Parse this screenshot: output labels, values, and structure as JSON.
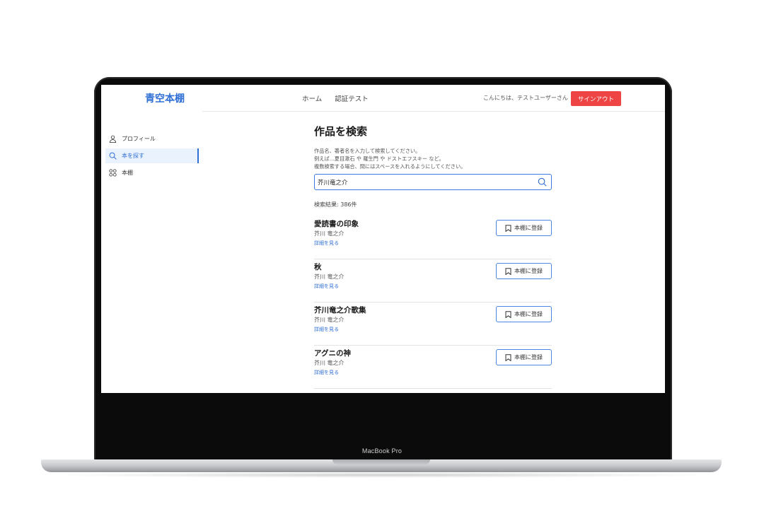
{
  "device": {
    "label": "MacBook Pro"
  },
  "header": {
    "logo": "青空本棚",
    "nav": [
      {
        "label": "ホーム"
      },
      {
        "label": "認証テスト"
      }
    ],
    "greeting": "こんにちは、テストユーザーさん",
    "signout_label": "サインアウト",
    "signout_color": "#ef4444",
    "accent_color": "#2f6fd6"
  },
  "sidebar": {
    "items": [
      {
        "label": "プロフィール",
        "icon": "user-icon",
        "active": false
      },
      {
        "label": "本を探す",
        "icon": "search-icon",
        "active": true
      },
      {
        "label": "本棚",
        "icon": "grid-icon",
        "active": false
      }
    ]
  },
  "main": {
    "title": "作品を検索",
    "help_lines": [
      "作品名、著者名を入力して検索してください。",
      "例えば…夏目漱石 や 羅生門 や ドストエフスキー など。",
      "複数検索する場合、間にはスペースを入れるようにしてください。"
    ],
    "search": {
      "value": "芥川竜之介",
      "button_icon": "search-icon"
    },
    "result_count": "検索結果: 386件",
    "results": [
      {
        "title": "愛読書の印象",
        "author": "芥川 竜之介",
        "link": "詳細を見る",
        "button": "本棚に登録"
      },
      {
        "title": "秋",
        "author": "芥川 竜之介",
        "link": "詳細を見る",
        "button": "本棚に登録"
      },
      {
        "title": "芥川竜之介歌集",
        "author": "芥川 竜之介",
        "link": "詳細を見る",
        "button": "本棚に登録"
      },
      {
        "title": "アグニの神",
        "author": "芥川 竜之介",
        "link": "詳細を見る",
        "button": "本棚に登録"
      }
    ]
  }
}
